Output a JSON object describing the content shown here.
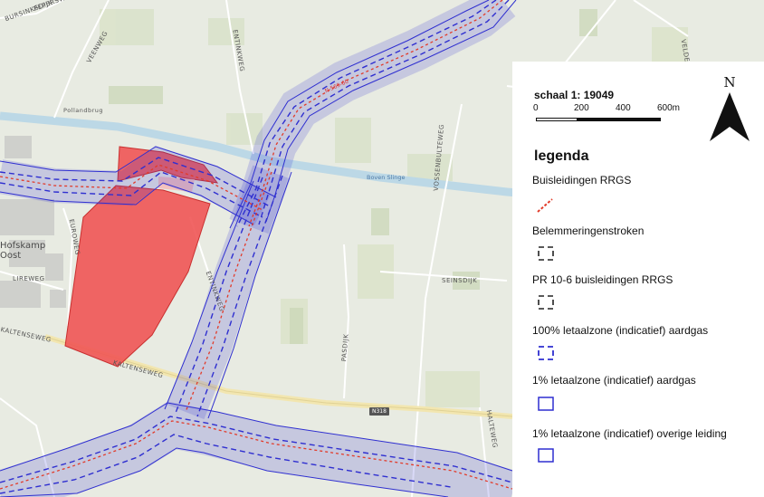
{
  "map": {
    "labels": {
      "buursinksdijk": "BURSINKSDIJK",
      "pepersweg": "PEPERSWEG",
      "veenweg": "VEENWEG",
      "entinkweg_north": "ENTINKWEG",
      "entinkweg_south": "ENTINKWEG",
      "pollandbrug": "Pollandbrug",
      "berkel": "Boven Slinge",
      "eurovweg": "EUROWEG",
      "lireweg": "LIREWEG",
      "hofskamp": "Hofskamp Oost",
      "vossenbulteweg": "VOSSENBULTEWEG",
      "seinsdijk": "SEINSDIJK",
      "pasdijk": "PASDIJK",
      "kaltenseweg_west": "KALTENSEWEG",
      "kaltenseweg_mid": "KALTENSEWEG",
      "haltweg": "HALTEWEG",
      "velde": "VELDE",
      "road_number": "N318",
      "pipeline_code": "N-569-60"
    }
  },
  "legend": {
    "scale_title": "schaal 1: 19049",
    "scale_ticks": [
      "0",
      "200",
      "400",
      "600m"
    ],
    "north_label": "N",
    "title": "legenda",
    "items": [
      {
        "label": "Buisleidingen RRGS",
        "symbol": "red-dashed-line"
      },
      {
        "label": "Belemmeringenstroken",
        "symbol": "black-dashed-box"
      },
      {
        "label": "PR 10-6 buisleidingen RRGS",
        "symbol": "black-dashed-box"
      },
      {
        "label": "100% letaalzone (indicatief) aardgas",
        "symbol": "blue-dashed-box"
      },
      {
        "label": "1% letaalzone (indicatief) aardgas",
        "symbol": "blue-solid-box"
      },
      {
        "label": "1% letaalzone (indicatief) overige leiding",
        "symbol": "blue-solid-box"
      }
    ]
  },
  "colors": {
    "plan_area": "#f05555",
    "pipeline": "#e23b2a",
    "zone": "#2f2fd0",
    "map_background": "#e9ece3",
    "water": "#bcd8e6"
  }
}
